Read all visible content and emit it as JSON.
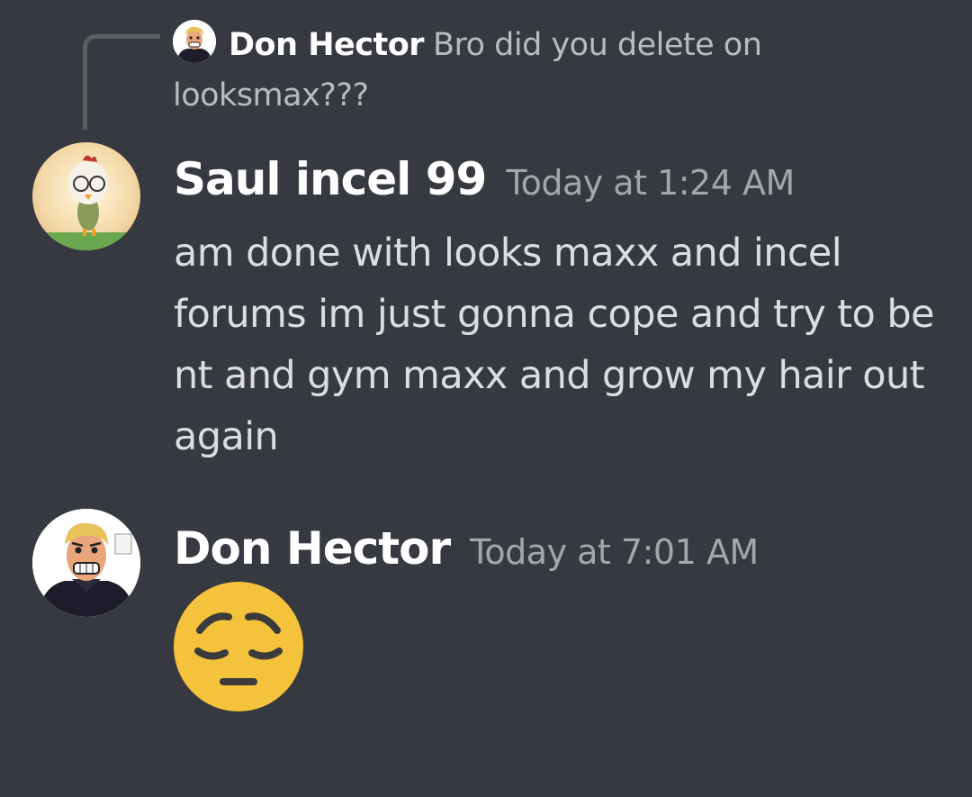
{
  "reply": {
    "author": "Don Hector",
    "text": "Bro did you delete on looksmax???"
  },
  "messages": [
    {
      "author": "Saul incel 99",
      "timestamp": "Today at 1:24 AM",
      "content": "am done with looks maxx and incel forums im just gonna cope and try to be nt and gym maxx and grow my hair out again",
      "avatar_icon": "chick-cartoon-avatar"
    },
    {
      "author": "Don Hector",
      "timestamp": "Today at 7:01 AM",
      "content": "",
      "emoji": "pensive-face-emoji",
      "avatar_icon": "comic-man-avatar"
    }
  ],
  "colors": {
    "background": "#36393f",
    "username": "#ffffff",
    "message_text": "#dcddde",
    "timestamp": "#a3a6aa",
    "reply_text": "#b9bbbe",
    "reply_spine": "#5a5d62",
    "emoji_yellow": "#f5c33b"
  }
}
